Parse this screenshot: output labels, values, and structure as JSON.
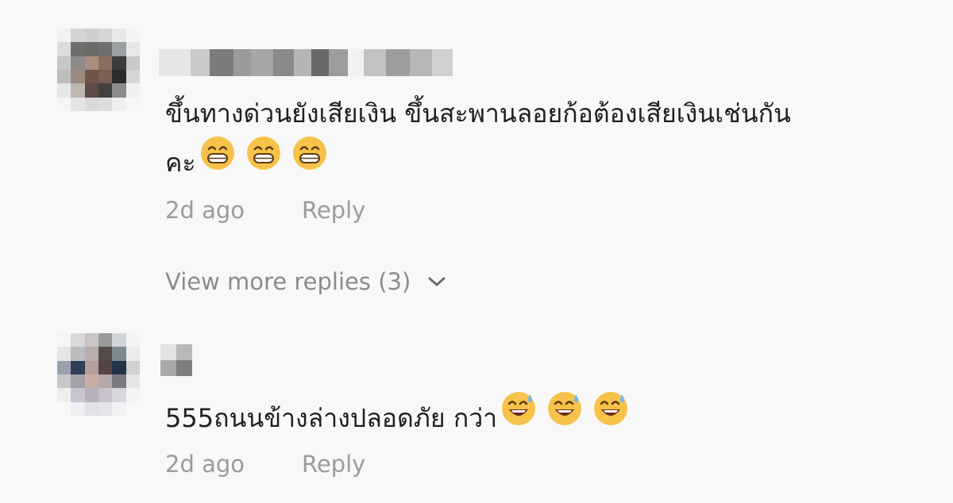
{
  "comments": [
    {
      "text_line1": "ขึ้นทางด่วนยังเสียเงิน ขึ้นสะพานลอยก้อต้องเสียเงินเช่นกัน",
      "text_line2": "คะ",
      "emoji": "grin-icon",
      "emoji_count": 3,
      "timestamp": "2d ago",
      "reply_label": "Reply",
      "view_more": "View more replies (3)"
    },
    {
      "text_line1": "555ถนนข้างล่างปลอดภัย กว่า",
      "emoji": "sweat-smile-icon",
      "emoji_count": 3,
      "timestamp": "2d ago",
      "reply_label": "Reply"
    }
  ],
  "colors": {
    "background": "#f8f8f8",
    "text": "#1f1f1f",
    "meta": "#9b9b9b",
    "emoji_yellow": "#f7c24a"
  }
}
